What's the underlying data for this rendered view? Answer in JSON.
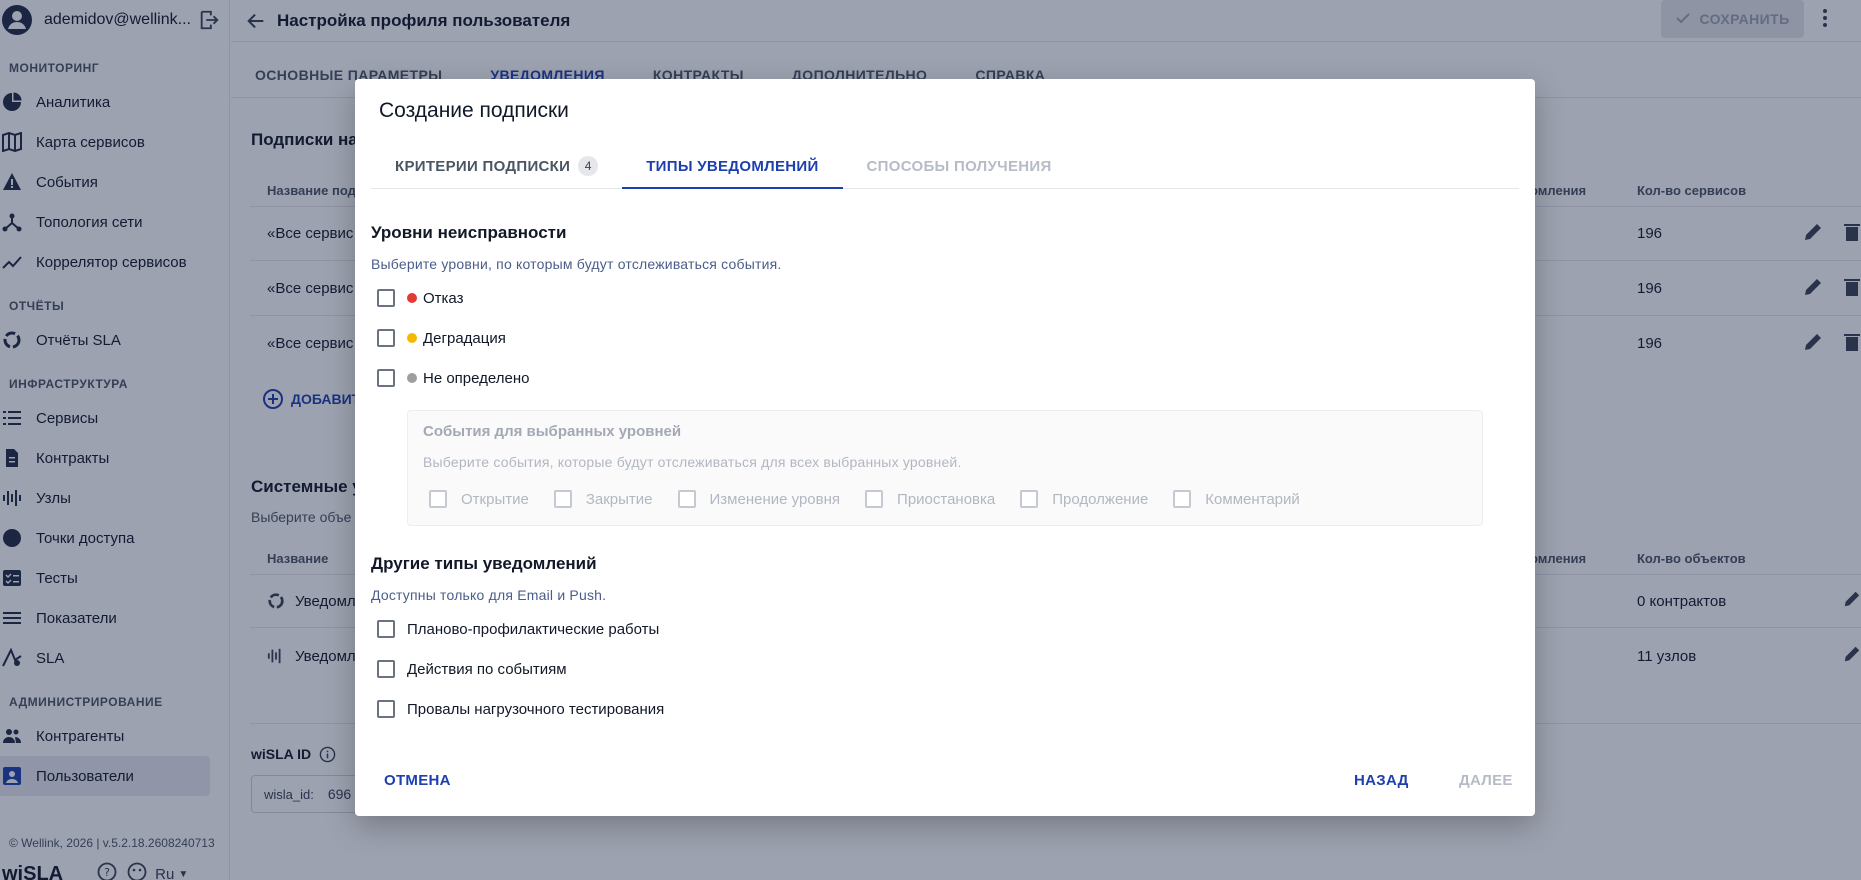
{
  "sidebar": {
    "user_email": "ademidov@wellink...",
    "sections": [
      {
        "label": "МОНИТОРИНГ",
        "items": [
          {
            "label": "Аналитика",
            "icon": "pie-chart-icon"
          },
          {
            "label": "Карта сервисов",
            "icon": "map-icon"
          },
          {
            "label": "События",
            "icon": "warning-icon"
          },
          {
            "label": "Топология сети",
            "icon": "topology-icon"
          },
          {
            "label": "Коррелятор сервисов",
            "icon": "trend-icon"
          }
        ]
      },
      {
        "label": "ОТЧЁТЫ",
        "items": [
          {
            "label": "Отчёты SLA",
            "icon": "donut-icon"
          }
        ]
      },
      {
        "label": "ИНФРАСТРУКТУРА",
        "items": [
          {
            "label": "Сервисы",
            "icon": "list-icon"
          },
          {
            "label": "Контракты",
            "icon": "document-icon"
          },
          {
            "label": "Узлы",
            "icon": "nodes-icon"
          },
          {
            "label": "Точки доступа",
            "icon": "access-point-icon"
          },
          {
            "label": "Тесты",
            "icon": "checklist-icon"
          },
          {
            "label": "Показатели",
            "icon": "metrics-icon"
          },
          {
            "label": "SLA",
            "icon": "sla-icon"
          }
        ]
      },
      {
        "label": "АДМИНИСТРИРОВАНИЕ",
        "items": [
          {
            "label": "Контрагенты",
            "icon": "people-icon"
          },
          {
            "label": "Пользователи",
            "icon": "user-card-icon"
          }
        ]
      }
    ],
    "footer": "© Wellink, 2026 | v.5.2.18.2608240713",
    "brand": "wiSLA",
    "lang": "Ru"
  },
  "header": {
    "title": "Настройка профиля пользователя",
    "save_label": "СОХРАНИТЬ"
  },
  "main_tabs": [
    "ОСНОВНЫЕ ПАРАМЕТРЫ",
    "УВЕДОМЛЕНИЯ",
    "КОНТРАКТЫ",
    "ДОПОЛНИТЕЛЬНО",
    "СПРАВКА"
  ],
  "background": {
    "subscriptions_title": "Подписки на",
    "col_name": "Название подп",
    "col_notifications": "омления",
    "col_services": "Кол-во сервисов",
    "rows": [
      {
        "name": "«Все сервис",
        "count": "196"
      },
      {
        "name": "«Все сервис",
        "count": "196"
      },
      {
        "name": "«Все сервис",
        "count": "196"
      }
    ],
    "add_label": "ДОБАВИТ",
    "system_title": "Системные у",
    "system_hint": "Выберите объе",
    "col_name2": "Название",
    "col_notifications2": "омления",
    "col_objects": "Кол-во объектов",
    "system_rows": [
      {
        "name": "Уведомл",
        "count": "0 контрактов"
      },
      {
        "name": "Уведомл",
        "count": "11 узлов"
      }
    ],
    "wisla_id_label": "wiSLA ID",
    "wisla_id_field": "wisla_id:",
    "wisla_id_value": "696"
  },
  "dialog": {
    "title": "Создание подписки",
    "tabs": [
      {
        "label": "КРИТЕРИИ ПОДПИСКИ",
        "badge": "4"
      },
      {
        "label": "ТИПЫ УВЕДОМЛЕНИЙ"
      },
      {
        "label": "СПОСОБЫ ПОЛУЧЕНИЯ"
      }
    ],
    "levels_title": "Уровни неисправности",
    "levels_hint": "Выберите уровни, по которым будут отслеживаться события.",
    "levels": [
      {
        "label": "Отказ",
        "color": "#e53935"
      },
      {
        "label": "Деградация",
        "color": "#f5b800"
      },
      {
        "label": "Не определено",
        "color": "#9e9e9e"
      }
    ],
    "events_title": "События для выбранных уровней",
    "events_hint": "Выберите события, которые будут отслеживаться для всех выбранных уровней.",
    "events": [
      "Открытие",
      "Закрытие",
      "Изменение уровня",
      "Приостановка",
      "Продолжение",
      "Комментарий"
    ],
    "other_title": "Другие типы уведомлений",
    "other_hint": "Доступны только для Email и Push.",
    "other": [
      "Планово-профилактические работы",
      "Действия по событиям",
      "Провалы нагрузочного тестирования"
    ],
    "cancel_label": "ОТМЕНА",
    "back_label": "НАЗАД",
    "next_label": "ДАЛЕЕ"
  },
  "colors": {
    "accent": "#1e40af",
    "disabled": "#b6bcc6",
    "overlay": "rgba(22,34,66,0.42)"
  }
}
